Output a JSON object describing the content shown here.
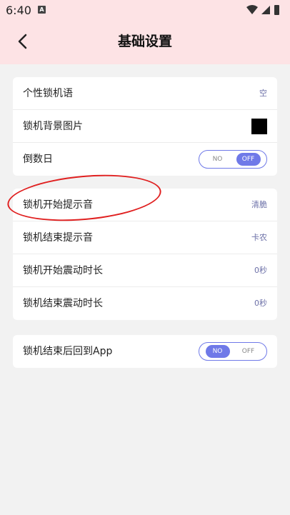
{
  "status_bar": {
    "time": "6:40",
    "notification": "A"
  },
  "header": {
    "title": "基础设置",
    "back_icon": "chevron-left-icon"
  },
  "group1": [
    {
      "label": "个性锁机语",
      "value": "空"
    },
    {
      "label": "锁机背景图片",
      "swatch_color": "#000000"
    },
    {
      "label": "倒数日",
      "toggle": {
        "no": "NO",
        "off": "OFF",
        "selected": "OFF"
      }
    }
  ],
  "group2": [
    {
      "label": "锁机开始提示音",
      "value": "清脆"
    },
    {
      "label": "锁机结束提示音",
      "value": "卡农"
    },
    {
      "label": "锁机开始震动时长",
      "value": "0秒"
    },
    {
      "label": "锁机结束震动时长",
      "value": "0秒"
    }
  ],
  "group3": [
    {
      "label": "锁机结束后回到App",
      "toggle": {
        "no": "NO",
        "off": "OFF",
        "selected": "NO"
      }
    }
  ],
  "colors": {
    "accent": "#6f79e8",
    "header_bg": "#fde3e5",
    "annotation": "#e02020"
  }
}
